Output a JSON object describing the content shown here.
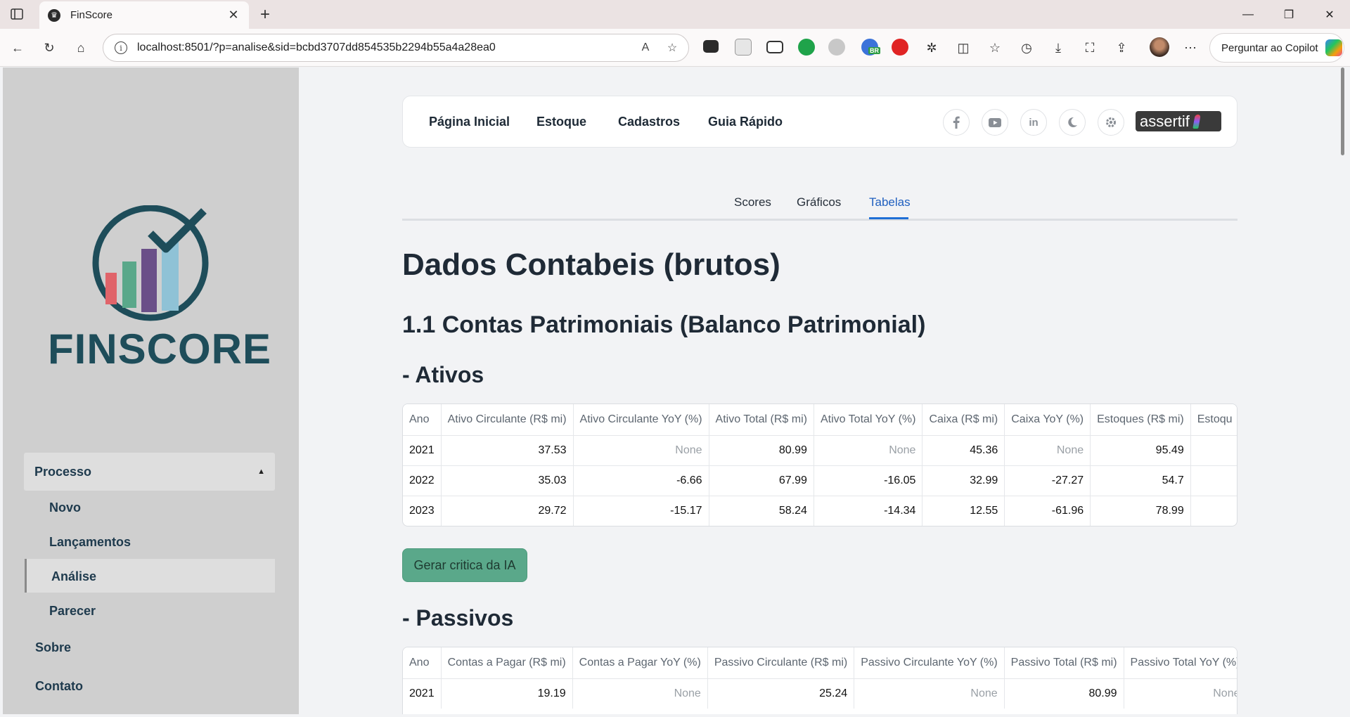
{
  "browser": {
    "tab_title": "FinScore",
    "tab_close": "✕",
    "new_tab": "+",
    "url": "localhost:8501/?p=analise&sid=bcbd3707dd854535b2294b55a4a28ea0",
    "copilot_label": "Perguntar ao Copilot",
    "ext_badge": "BR",
    "window_controls": {
      "minimize": "—",
      "restore": "❐",
      "close": "✕"
    }
  },
  "sidebar": {
    "logo_text": "FINSCORE",
    "logo_colors": {
      "ring": "#1e4d5a",
      "bar1": "#e0646a",
      "bar2": "#5aa88a",
      "bar3": "#6a4f88",
      "bar4": "#8fc2d6"
    },
    "group_label": "Processo",
    "group_caret": "▲",
    "sub_items": [
      "Novo",
      "Lançamentos",
      "Análise",
      "Parecer"
    ],
    "active_item": "Análise",
    "top_items": [
      "Sobre",
      "Contato"
    ]
  },
  "navbar": {
    "links": [
      "Página Inicial",
      "Estoque",
      "Cadastros",
      "Guia Rápido"
    ],
    "icons": [
      "facebook-icon",
      "youtube-icon",
      "linkedin-icon",
      "moon-icon",
      "gear-icon"
    ],
    "linkedin_text": "in",
    "brand": "assertif"
  },
  "tabs": {
    "items": [
      "Scores",
      "Gráficos",
      "Tabelas"
    ],
    "active": "Tabelas"
  },
  "content": {
    "title": "Dados Contabeis (brutos)",
    "section": "1.1 Contas Patrimoniais (Balanco Patrimonial)",
    "ativos_heading": "- Ativos",
    "passivos_heading": "- Passivos",
    "ai_button": "Gerar critica da IA"
  },
  "ativos_table": {
    "headers": [
      "Ano",
      "Ativo Circulante (R$ mi)",
      "Ativo Circulante YoY (%)",
      "Ativo Total (R$ mi)",
      "Ativo Total YoY (%)",
      "Caixa (R$ mi)",
      "Caixa YoY (%)",
      "Estoques (R$ mi)",
      "Estoqu"
    ],
    "rows": [
      [
        "2021",
        "37.53",
        "None",
        "80.99",
        "None",
        "45.36",
        "None",
        "95.49",
        ""
      ],
      [
        "2022",
        "35.03",
        "-6.66",
        "67.99",
        "-16.05",
        "32.99",
        "-27.27",
        "54.7",
        ""
      ],
      [
        "2023",
        "29.72",
        "-15.17",
        "58.24",
        "-14.34",
        "12.55",
        "-61.96",
        "78.99",
        ""
      ]
    ]
  },
  "passivos_table": {
    "headers": [
      "Ano",
      "Contas a Pagar (R$ mi)",
      "Contas a Pagar YoY (%)",
      "Passivo Circulante (R$ mi)",
      "Passivo Circulante YoY (%)",
      "Passivo Total (R$ mi)",
      "Passivo Total YoY (%)"
    ],
    "rows": [
      [
        "2021",
        "19.19",
        "None",
        "25.24",
        "None",
        "80.99",
        "None"
      ]
    ]
  }
}
